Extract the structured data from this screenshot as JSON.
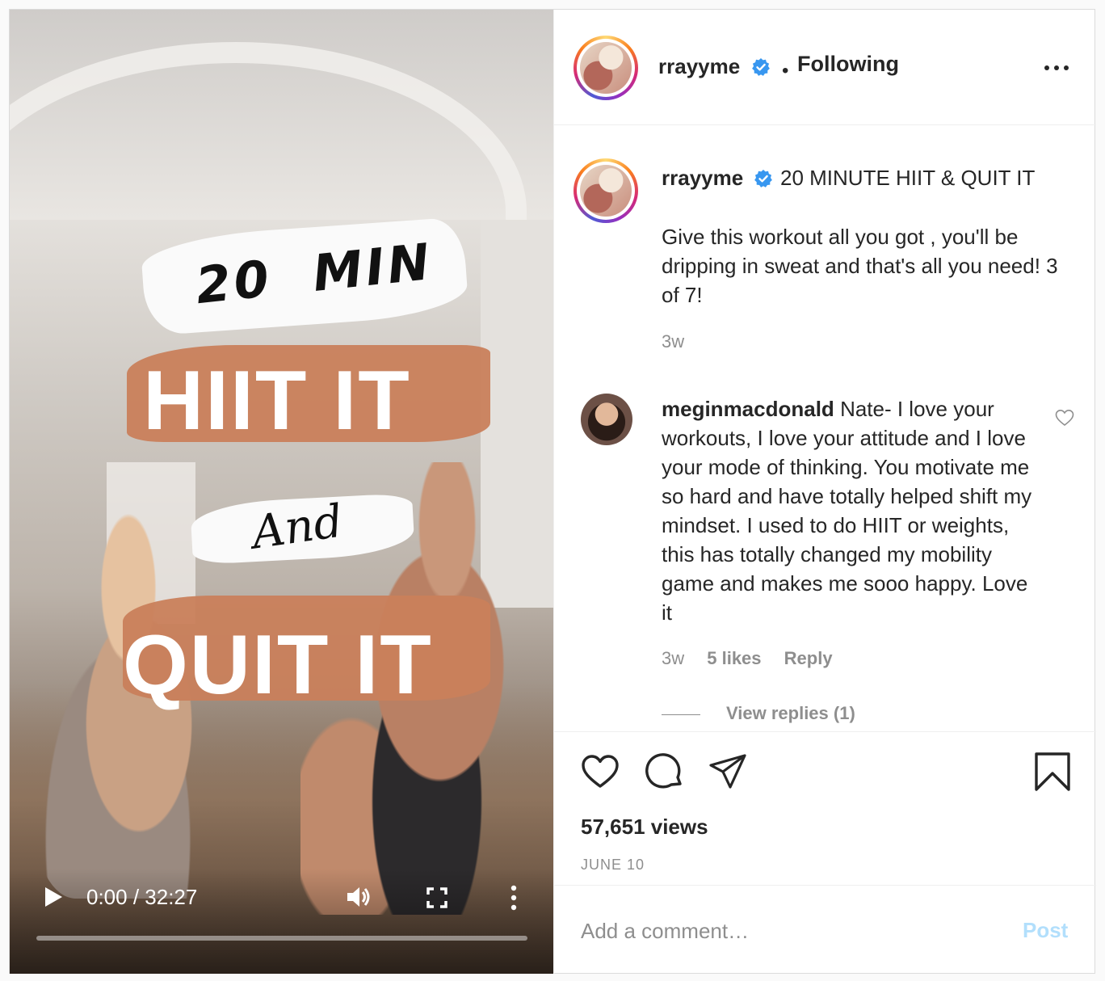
{
  "video": {
    "overlay": {
      "line1": "20  MIN",
      "line2": "HIIT IT",
      "line3": "And",
      "line4": "QUIT IT"
    },
    "time": "0:00 / 32:27",
    "progress": 0.0
  },
  "header": {
    "username": "rrayyme",
    "separator": "•",
    "follow_status": "Following"
  },
  "caption": {
    "username": "rrayyme",
    "title": "20 MINUTE HIIT & QUIT IT",
    "body": "Give this workout all you got , you'll be dripping in sweat and that's all you need! 3 of 7!",
    "time": "3w"
  },
  "comment": {
    "username": "meginmacdonald",
    "text": "Nate- I love your workouts, I love your attitude and I love your mode of thinking. You motivate me so hard and have totally helped shift my mindset. I used to do HIIT or weights, this has totally changed my mobility game and makes me sooo happy. Love it",
    "time": "3w",
    "likes": "5 likes",
    "reply": "Reply",
    "view_replies": "View replies (1)"
  },
  "actions": {
    "views": "57,651 views",
    "date": "JUNE 10"
  },
  "comment_bar": {
    "placeholder": "Add a comment…",
    "post_label": "Post"
  },
  "colors": {
    "verified": "#3897f0",
    "post_disabled": "#b2dffc",
    "brush_orange": "#c9805b"
  }
}
